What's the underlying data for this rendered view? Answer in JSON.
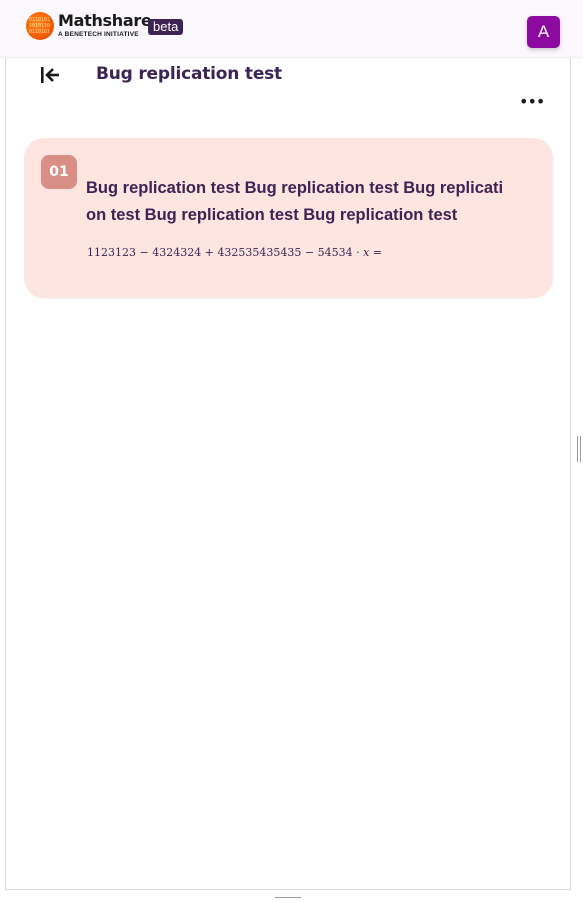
{
  "header": {
    "brand_name": "Mathshare",
    "brand_tagline": "A BENETECH INITIATIVE",
    "beta_label": "beta",
    "avatar_initial": "A",
    "logo_icon": "mathshare-logo-icon",
    "colors": {
      "beta_bg": "#3d2454",
      "avatar_bg": "#8c0aa0"
    }
  },
  "toolbar": {
    "back_icon": "collapse-left-icon",
    "title": "Bug replication test",
    "more_label": "•••"
  },
  "problems": [
    {
      "number": "01",
      "text": "Bug replication test Bug replication test Bug replication test Bug replication test Bug replication test",
      "expression": "1123123 − 4324324 + 432535435435 − 54534 · 𝑥 ="
    }
  ],
  "colors": {
    "accent_text": "#3d2454",
    "card_bg": "#ffe5e0",
    "badge_bg": "#d98f85"
  }
}
